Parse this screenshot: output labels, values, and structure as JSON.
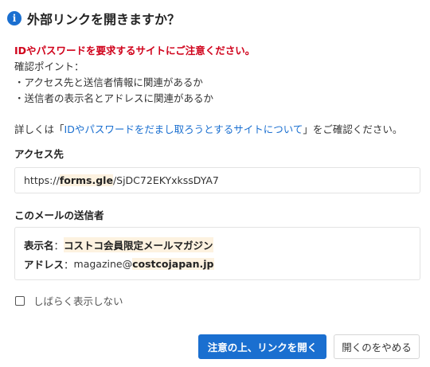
{
  "dialog": {
    "title": "外部リンクを開きますか？",
    "warning": "IDやパスワードを要求するサイトにご注意ください。",
    "checkpoints_heading": "確認ポイント：",
    "checkpoints": [
      "・アクセス先と送信者情報に関連があるか",
      "・送信者の表示名とアドレスに関連があるか"
    ],
    "details": {
      "prefix": "詳しくは「",
      "link": "IDやパスワードをだまし取ろうとするサイトについて",
      "suffix": "」をご確認ください。"
    },
    "access": {
      "label": "アクセス先",
      "url_prefix": "https://",
      "url_domain": "forms.gle",
      "url_path": "/SjDC72EKYxkssDYA7"
    },
    "sender": {
      "label": "このメールの送信者",
      "display_name_key": "表示名",
      "display_name": "コストコ会員限定メールマガジン",
      "address_key": "アドレス",
      "address_local": "magazine@",
      "address_domain": "costcojapan.jp",
      "separator": "："
    },
    "checkbox_label": "しばらく表示しない",
    "checkbox_checked": false,
    "primary_button": "注意の上、リンクを開く",
    "secondary_button": "開くのをやめる"
  },
  "colors": {
    "accent": "#1a6fd0",
    "warning": "#d0021b",
    "highlight": "#fdf2e0"
  }
}
